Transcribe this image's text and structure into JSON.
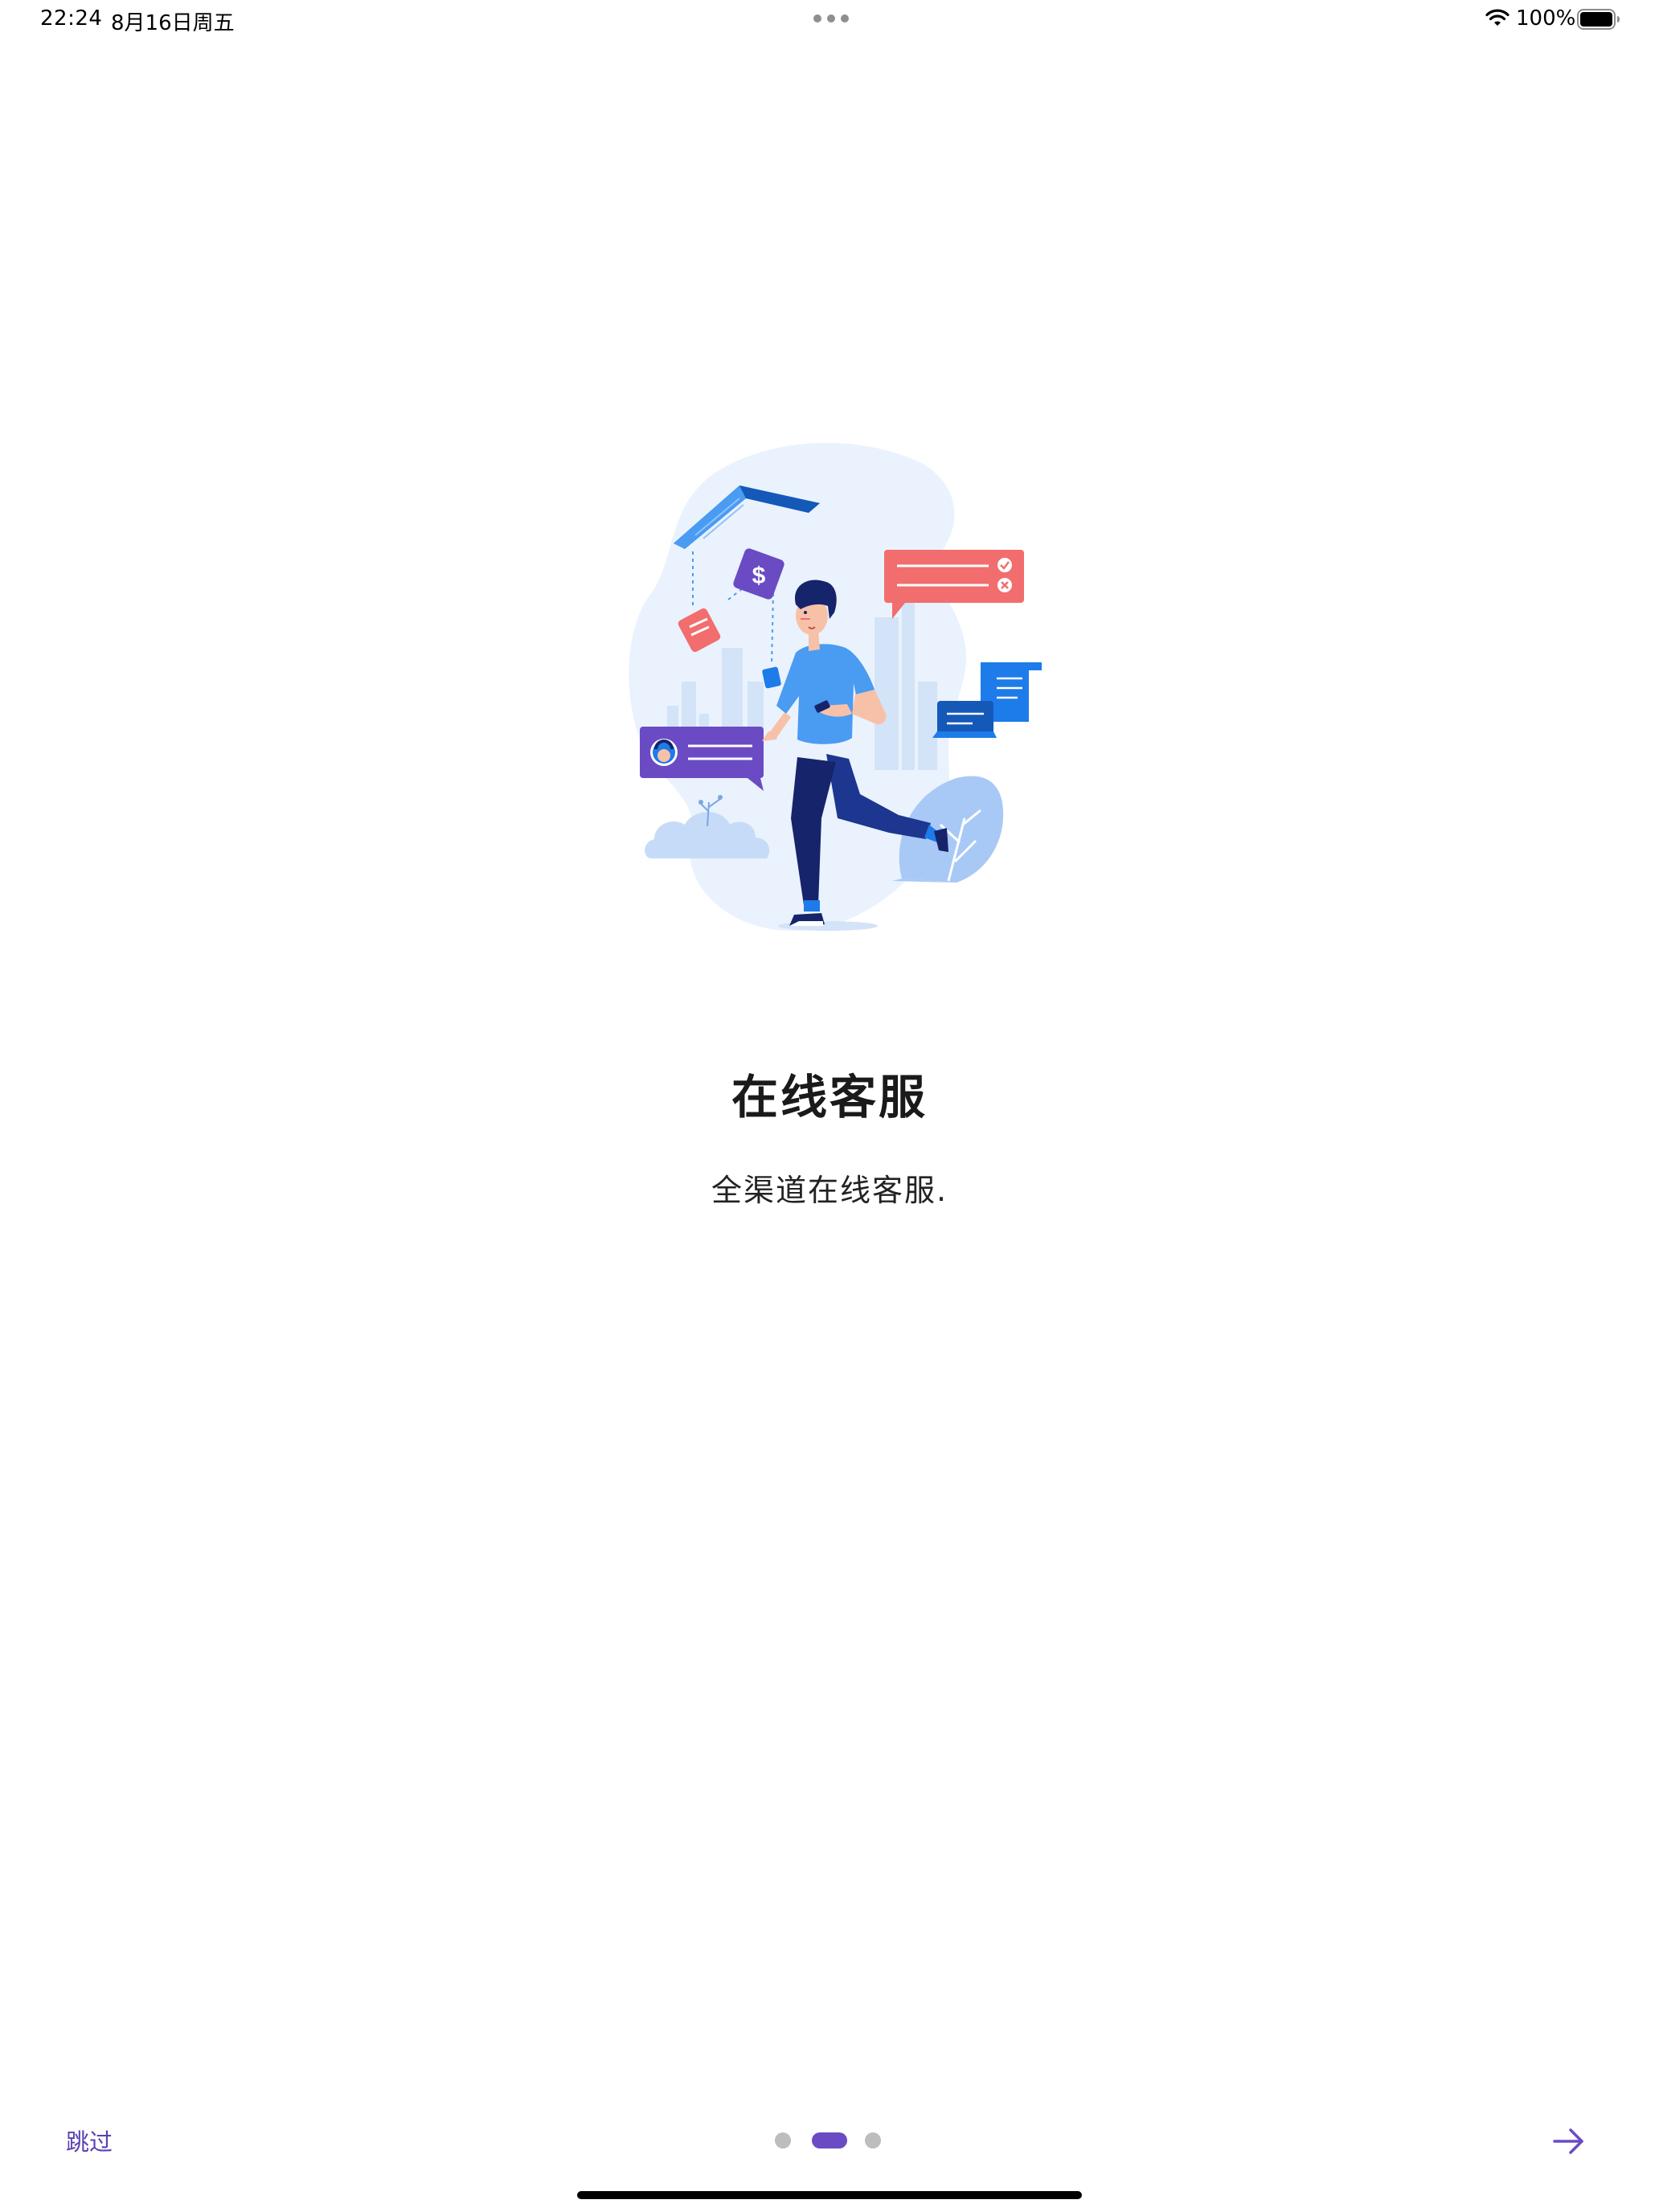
{
  "status_bar": {
    "time": "22:24",
    "date": "8月16日周五",
    "battery_percent": "100%",
    "battery_level": 1.0,
    "icons": [
      "wifi-icon",
      "battery-icon",
      "multitask-dots"
    ]
  },
  "onboarding": {
    "title": "在线客服",
    "subtitle": "全渠道在线客服.",
    "illustration": "customer-service-illustration"
  },
  "navigation": {
    "skip_label": "跳过",
    "page_count": 3,
    "current_page": 2,
    "next_icon": "arrow-right-icon"
  },
  "colors": {
    "accent": "#6a4bc4",
    "skip_text": "#5b3fb3",
    "inactive_dot": "#bdbdbd",
    "illustration_blue": "#1e7bea",
    "illustration_red": "#f26d6d",
    "illustration_purple": "#6a4bc4",
    "illustration_navy": "#16246b"
  }
}
